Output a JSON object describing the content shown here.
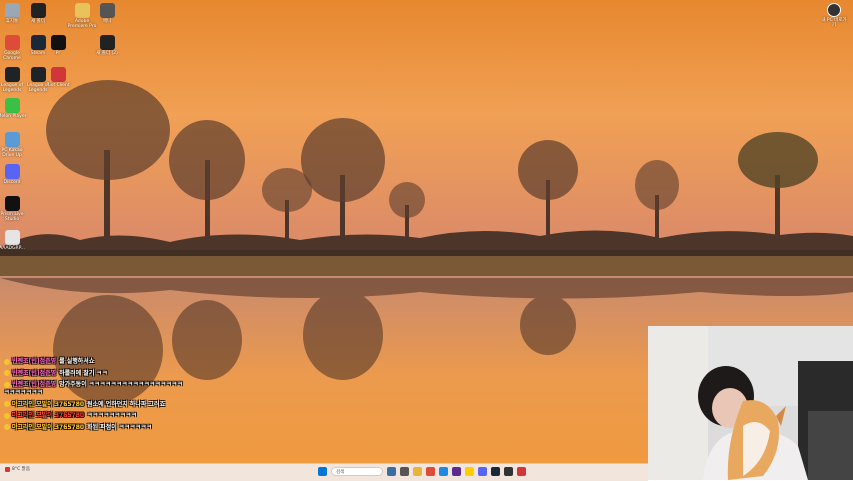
{
  "desktop_icons": [
    {
      "label": "휴지통",
      "name": "recycle-bin-icon",
      "color": "#9aa7b5"
    },
    {
      "label": "새 폴더",
      "name": "folder-shortcut-icon",
      "color": "#222"
    },
    {
      "label": "Adobe Premiere Pro",
      "name": "folder-icon",
      "color": "#e8c25a"
    },
    {
      "label": "애니",
      "name": "video-shortcut-icon",
      "color": "#555"
    },
    {
      "label": "Google Chrome",
      "name": "chrome-icon",
      "color": "#de4b39"
    },
    {
      "label": "Steam",
      "name": "steam-icon",
      "color": "#1b2838"
    },
    {
      "label": "Pr",
      "name": "premiere-icon",
      "color": "#111"
    },
    {
      "label": "새 폴더 (2)",
      "name": "folder-shortcut-icon-2",
      "color": "#222"
    },
    {
      "label": "League of Legends",
      "name": "lol-icon",
      "color": "#1e2328"
    },
    {
      "label": "League of Legends",
      "name": "lol-icon-2",
      "color": "#1e2328"
    },
    {
      "label": "Riot Client",
      "name": "riot-icon",
      "color": "#d13639"
    },
    {
      "label": "Melon Player",
      "name": "melon-icon",
      "color": "#3cbf45"
    },
    {
      "label": "PC Kakao Drive Up",
      "name": "kakao-drive-icon",
      "color": "#5a9bd5"
    },
    {
      "label": "Discord",
      "name": "discord-icon",
      "color": "#5865f2"
    },
    {
      "label": "Prism Live Studio",
      "name": "prism-icon",
      "color": "#111"
    },
    {
      "label": "AAADGRP...",
      "name": "app-icon",
      "color": "#e5e5e5"
    }
  ],
  "topright": {
    "label": "내 PC 바로가기",
    "icon": "settings-icon"
  },
  "chat": [
    {
      "name": "빈젠조(빈)정준영",
      "text": "를 실행하셔쇼",
      "name_color": "#ff66cc"
    },
    {
      "name": "빈젠조(빈)정준영",
      "text": "하룰러에 찰기 ㅋㅋ",
      "name_color": "#ff66cc"
    },
    {
      "name": "빈젠조(빈)정준영",
      "text": "망가주동이 ㅋㅋㅋㅋㅋㅋㅋㅋㅋㅋㅋㅋㅋㅋㅋㅋㅋㅋㅋㅋㅋㅋㅋㅋ",
      "name_color": "#ff66cc"
    },
    {
      "name": "야그라인 오알이 3765780",
      "text": "원소에 언하던지 하나파 그러죠",
      "name_color": "#ffcc33"
    },
    {
      "name": "야그라인 오알이 3765780",
      "text": "ㅋㅋㅋㅋㅋㅋㅋㅋㅋ",
      "name_color": "#ff3333"
    },
    {
      "name": "야그라인 오알이 3765780",
      "text": "화된 파정이 ㅋㅋㅋㅋㅋㅋ",
      "name_color": "#ffcc33"
    }
  ],
  "taskbar": {
    "weather": "8°C 맑음",
    "search_placeholder": "검색",
    "icons": [
      "windows-start-icon",
      "widgets-icon",
      "task-view-icon",
      "explorer-icon",
      "chrome-icon",
      "edge-icon",
      "store-icon",
      "kakao-icon",
      "discord-icon",
      "steam-icon",
      "obs-icon",
      "riot-icon"
    ],
    "icon_colors": [
      "#0078d4",
      "#3a6ea5",
      "#555",
      "#e8b43c",
      "#de4b39",
      "#1e88e5",
      "#5c2d91",
      "#ffcd00",
      "#5865f2",
      "#1b2838",
      "#333",
      "#d13639"
    ]
  }
}
